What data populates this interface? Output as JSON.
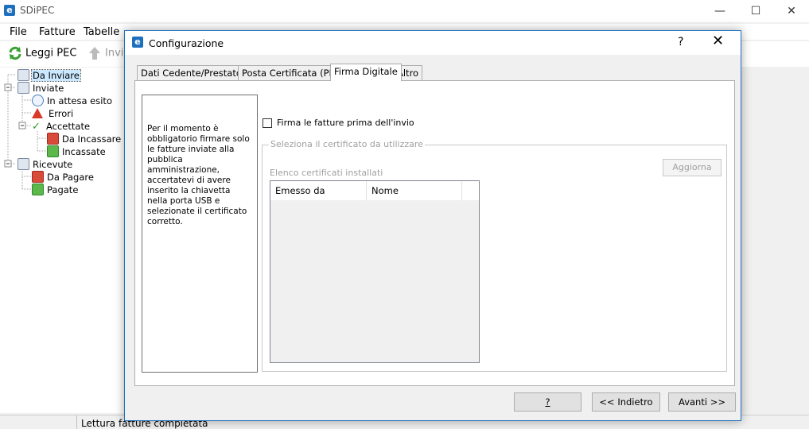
{
  "app": {
    "title": "SDiPEC",
    "icon": "e-logo-icon"
  },
  "window_controls": {
    "minimize": "—",
    "maximize": "☐",
    "close": "✕"
  },
  "menu": [
    "File",
    "Fatture",
    "Tabelle"
  ],
  "toolbar": {
    "read_pec": "Leggi PEC",
    "send": "Invia"
  },
  "tree": {
    "items": [
      {
        "label": "Da Inviare",
        "icon": "document-icon",
        "selected": true
      },
      {
        "label": "Inviate",
        "icon": "document-icon"
      },
      {
        "label": "In attesa esito",
        "icon": "clock-icon"
      },
      {
        "label": "Errori",
        "icon": "warning-icon"
      },
      {
        "label": "Accettate",
        "icon": "checkmark-icon"
      },
      {
        "label": "Da Incassare",
        "icon": "money-red-icon"
      },
      {
        "label": "Incassate",
        "icon": "money-green-icon"
      },
      {
        "label": "Ricevute",
        "icon": "document-icon"
      },
      {
        "label": "Da Pagare",
        "icon": "money-red-icon"
      },
      {
        "label": "Pagate",
        "icon": "money-green-icon"
      }
    ]
  },
  "status": {
    "text": "Lettura fatture completata"
  },
  "dialog": {
    "title": "Configurazione",
    "help": "?",
    "close": "✕",
    "tabs": [
      "Dati Cedente/Prestatore",
      "Posta Certificata (PEC)",
      "Firma Digitale",
      "Altro"
    ],
    "active_tab": "Firma Digitale",
    "note": "Per il momento è obbligatorio firmare solo le fatture inviate alla pubblica amministrazione, accertatevi di avere inserito la chiavetta nella porta USB e selezionate il certificato corretto.",
    "sign_checkbox": {
      "label": "Firma le fatture prima dell'invio",
      "checked": false
    },
    "group_title": "Seleziona il certificato da utilizzare",
    "list_label": "Elenco certificati installati",
    "refresh_button": "Aggiorna",
    "columns": [
      "Emesso da",
      "Nome"
    ],
    "buttons": {
      "help": "?",
      "back": "<< Indietro",
      "next": "Avanti >>"
    }
  },
  "colors": {
    "accent": "#1f6fbf",
    "selection": "#cce8ff"
  }
}
